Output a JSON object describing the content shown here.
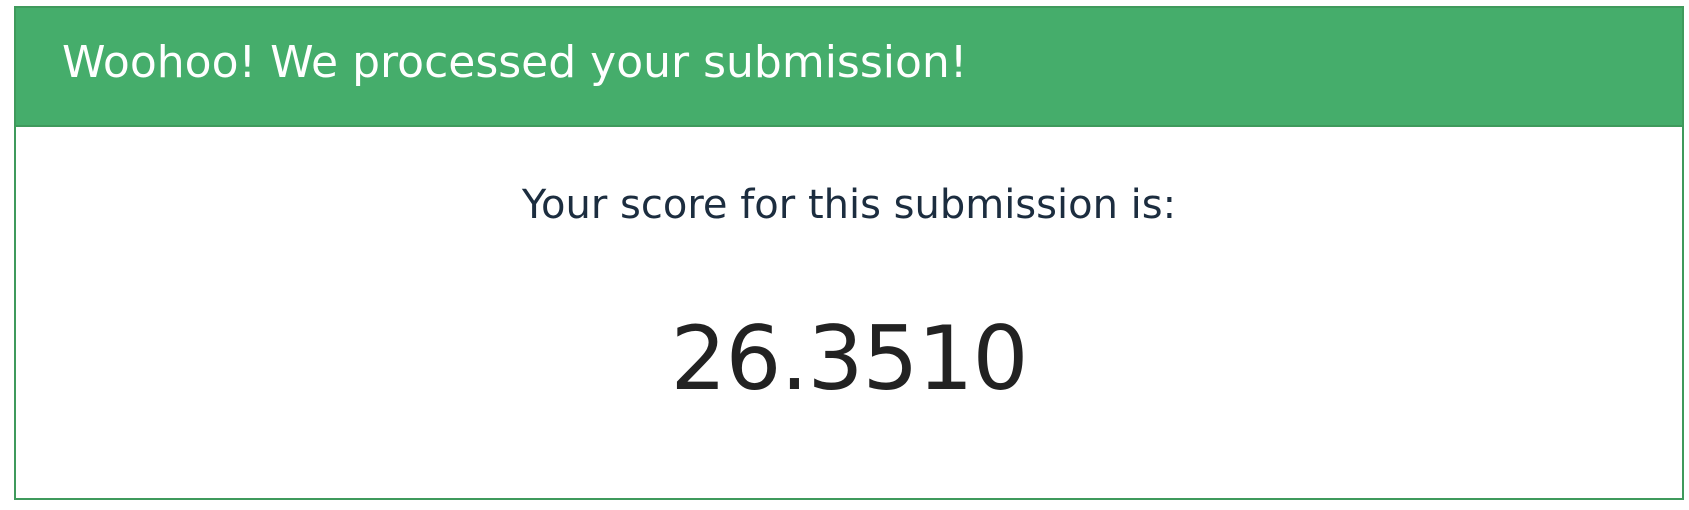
{
  "header": {
    "title": "Woohoo! We processed your submission!"
  },
  "result": {
    "label": "Your score for this submission is:",
    "score": "26.3510"
  },
  "colors": {
    "header_background": "#45ad6b",
    "border": "#3f9a5c",
    "label_text": "#1c2d3f",
    "score_text": "#222222"
  }
}
